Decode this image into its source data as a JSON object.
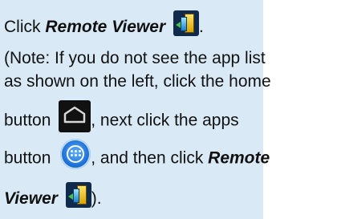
{
  "instructions": {
    "line1": {
      "prefix": "Click ",
      "app_name": "Remote Viewer",
      "suffix": "."
    },
    "line2": "(Note: If you do not see the app list",
    "line3": "as shown on the left, click the home",
    "line4": {
      "prefix": "button",
      "suffix": ", next click the apps"
    },
    "line5": {
      "prefix": "button",
      "mid": ", and then click ",
      "app_name": "Remote"
    },
    "line6": {
      "app_name": "Viewer",
      "suffix": ")."
    }
  },
  "icons": {
    "remote_viewer": "remote-viewer-icon",
    "home": "home-icon",
    "apps": "apps-icon"
  },
  "colors": {
    "panel_background": "#d9eaf6",
    "text": "#111111"
  }
}
